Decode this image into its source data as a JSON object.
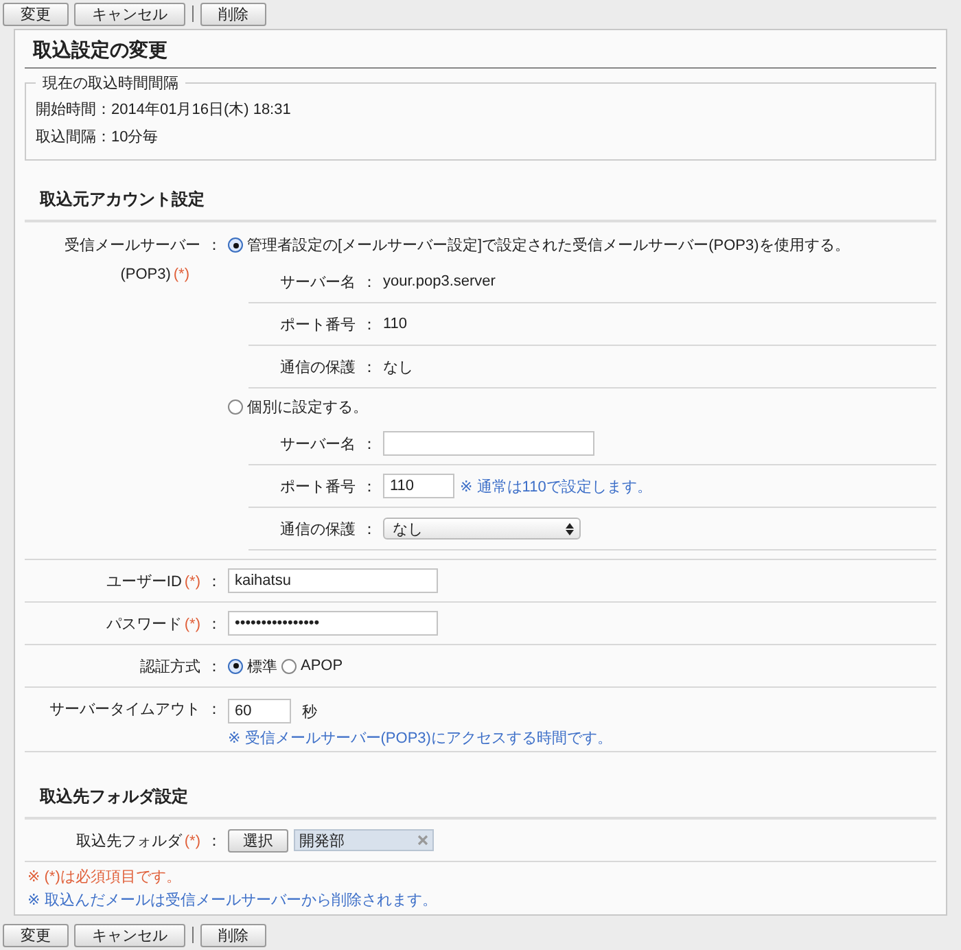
{
  "toolbar_top": {
    "buttons": [
      "変更",
      "キャンセル",
      "削除"
    ]
  },
  "title": "取込設定の変更",
  "current_interval": {
    "legend": "現在の取込時間間隔",
    "lines": [
      "開始時間：2014年01月16日(木) 18:31",
      "取込間隔：10分毎"
    ]
  },
  "account_section": {
    "heading": "取込元アカウント設定",
    "rows": [
      {
        "kind": "server",
        "label": "受信メールサーバー",
        "label_2": "(POP3)",
        "mark": "(*)",
        "sep": "：",
        "options": [
          {
            "label": "管理者設定の[メールサーバー設定]で設定された受信メールサーバー(POP3)を使用する。",
            "selected": true,
            "fields": [
              {
                "kind": "text",
                "label": "サーバー名",
                "sep": "：",
                "value": "your.pop3.server"
              },
              {
                "kind": "text",
                "label": "ポート番号",
                "sep": "：",
                "value": "110"
              },
              {
                "kind": "text",
                "label": "通信の保護",
                "sep": "：",
                "value": "なし"
              }
            ]
          },
          {
            "label": "個別に設定する。",
            "selected": false,
            "fields": [
              {
                "kind": "input",
                "label": "サーバー名",
                "sep": "："
              },
              {
                "kind": "short",
                "label": "ポート番号",
                "sep": "：",
                "value": "110",
                "note": "※ 通常は110で設定します。"
              },
              {
                "kind": "select",
                "label": "通信の保護",
                "sep": "：",
                "value": "なし"
              }
            ]
          }
        ]
      },
      {
        "kind": "input",
        "label": "ユーザーID",
        "mark": "(*)",
        "sep": "：",
        "value": "kaihatsu"
      },
      {
        "kind": "input",
        "label": "パスワード",
        "mark": "(*)",
        "sep": "：",
        "value": "••••••••••••••••"
      },
      {
        "kind": "radio",
        "label": "認証方式",
        "sep": "：",
        "options": [
          {
            "label": "標準",
            "selected": true
          },
          {
            "label": "APOP",
            "selected": false
          }
        ]
      },
      {
        "kind": "timeout",
        "label": "サーバータイムアウト",
        "sep": "：",
        "value": "60",
        "unit": "秒",
        "note": "※ 受信メールサーバー(POP3)にアクセスする時間です。"
      }
    ]
  },
  "folder_section": {
    "heading": "取込先フォルダ設定",
    "rows": [
      {
        "kind": "folder",
        "label": "取込先フォルダ",
        "mark": "(*)",
        "sep": "：",
        "button": "選択",
        "value": "開発部"
      }
    ]
  },
  "notes": [
    {
      "kind": "required",
      "text": "※ (*)は必須項目です。"
    },
    {
      "kind": "info",
      "text": "※ 取込んだメールは受信メールサーバーから削除されます。"
    }
  ],
  "toolbar_bottom": {
    "buttons": [
      "変更",
      "キャンセル",
      "削除"
    ]
  }
}
